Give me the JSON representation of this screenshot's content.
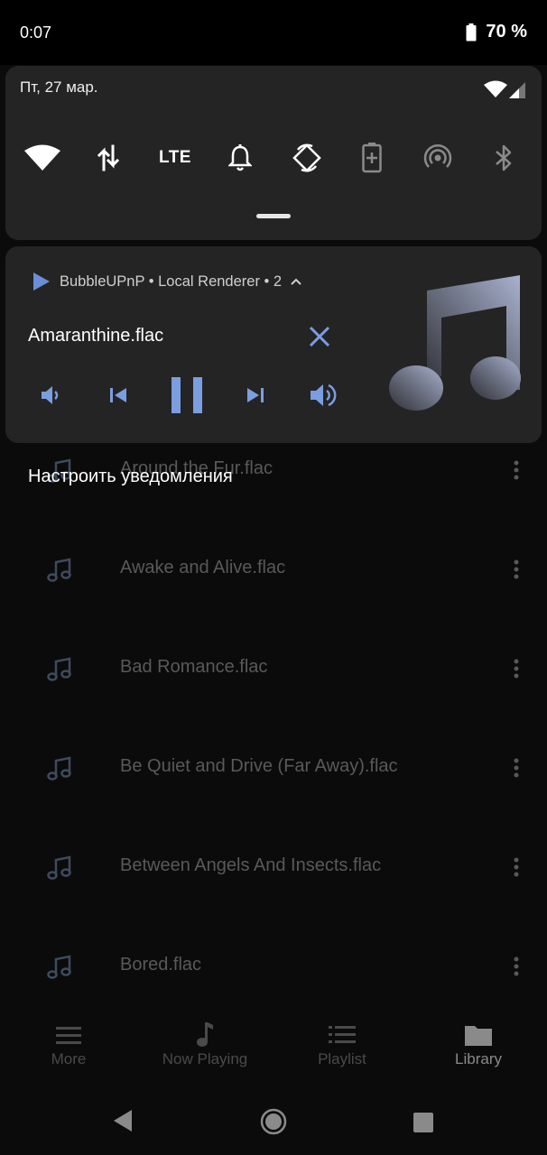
{
  "status_bar": {
    "time": "0:07",
    "battery": "70 %"
  },
  "quick_settings": {
    "date": "Пт, 27 мар.",
    "tiles": [
      "wifi-icon",
      "data-transfer-icon",
      "LTE",
      "bell-icon",
      "auto-rotate-icon",
      "battery-saver-icon",
      "hotspot-icon",
      "bluetooth-icon"
    ]
  },
  "media_notification": {
    "header": "BubbleUPnP • Local Renderer • 2",
    "title": "Amaranthine.flac",
    "accent_color": "#7b9ee0"
  },
  "app": {
    "configure_notifications": "Настроить уведомления",
    "tracks": [
      "Around the Fur.flac",
      "Awake and Alive.flac",
      "Bad Romance.flac",
      "Be Quiet and Drive (Far Away).flac",
      "Between Angels And Insects.flac",
      "Bored.flac"
    ],
    "bottom_nav": {
      "more": "More",
      "now_playing": "Now Playing",
      "playlist": "Playlist",
      "library": "Library"
    }
  }
}
